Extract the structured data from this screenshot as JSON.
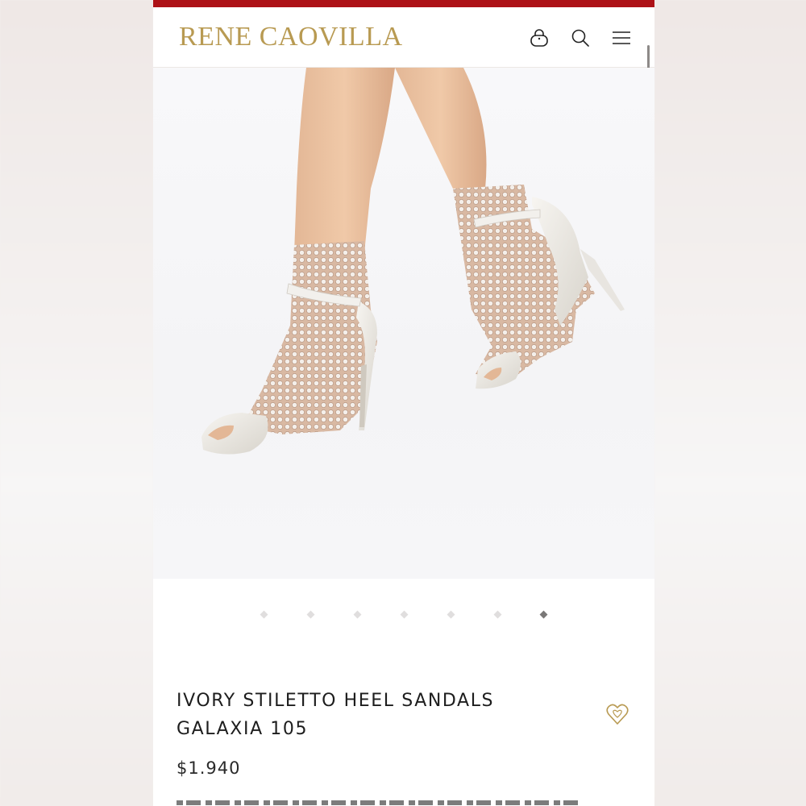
{
  "brand": {
    "name": "RENE CAOVILLA"
  },
  "header": {
    "icons": [
      "shopping-bag-icon",
      "search-icon",
      "menu-icon"
    ]
  },
  "gallery": {
    "slide_count": 7,
    "active_index": 6,
    "image_alt": "Ivory stiletto heel sandal with crystal mesh sock"
  },
  "product": {
    "title_line1": "IVORY STILETTO HEEL SANDALS",
    "title_line2": "GALAXIA 105",
    "price": "$1.940"
  },
  "colors": {
    "accent_red": "#ad1116",
    "brand_gold": "#b89a52",
    "text_dark": "#1d1d1d"
  }
}
